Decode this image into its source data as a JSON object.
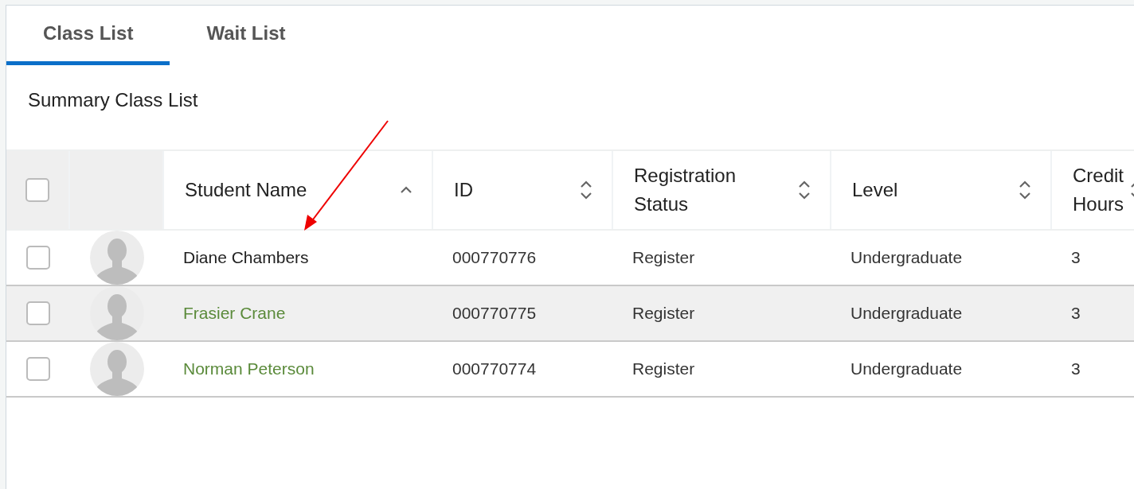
{
  "tabs": [
    {
      "label": "Class List",
      "selected": true
    },
    {
      "label": "Wait List",
      "selected": false
    }
  ],
  "section_title": "Summary Class List",
  "table": {
    "select_all": {
      "checked": false
    },
    "columns": [
      {
        "label": "Student Name",
        "sorted": true
      },
      {
        "label": "ID",
        "sorted": false
      },
      {
        "label": "Registration Status",
        "sorted": false
      },
      {
        "label": "Level",
        "sorted": false
      },
      {
        "label": "Credit Hours",
        "sorted": false
      }
    ],
    "rows": [
      {
        "checked": false,
        "highlighted": false,
        "link": false,
        "cells": [
          "Diane Chambers",
          "000770776",
          "Register",
          "Undergraduate",
          "3"
        ]
      },
      {
        "checked": false,
        "highlighted": true,
        "link": true,
        "cells": [
          "Frasier Crane",
          "000770775",
          "Register",
          "Undergraduate",
          "3"
        ]
      },
      {
        "checked": false,
        "highlighted": false,
        "link": true,
        "cells": [
          "Norman Peterson",
          "000770774",
          "Register",
          "Undergraduate",
          "3"
        ]
      }
    ]
  }
}
